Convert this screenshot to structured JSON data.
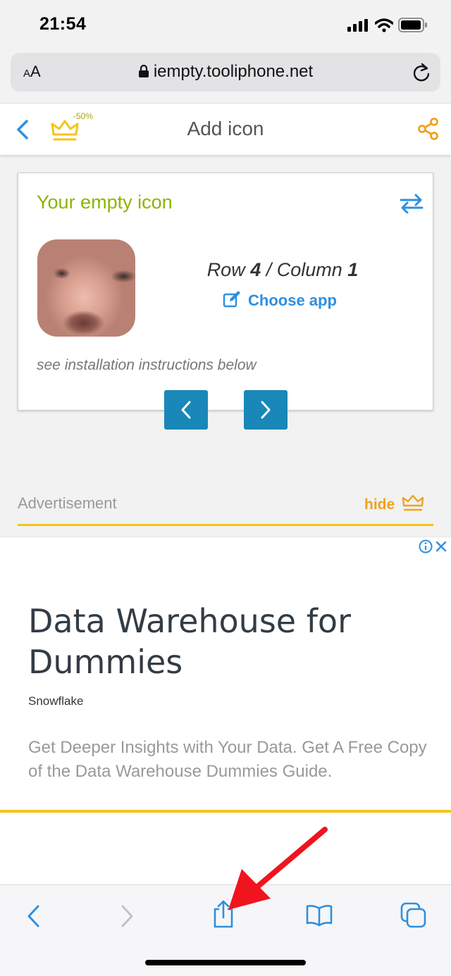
{
  "status_bar": {
    "time": "21:54"
  },
  "browser": {
    "text_size_label_small": "A",
    "text_size_label_big": "A",
    "url": "iempty.tooliphone.net"
  },
  "header": {
    "title": "Add icon",
    "discount": "-50%"
  },
  "icon_card": {
    "title": "Your empty icon",
    "row_prefix": "Row ",
    "row": "4",
    "separator": " / Column ",
    "column": "1",
    "choose_app": "Choose app",
    "instructions": "see installation instructions below"
  },
  "ad_section": {
    "label": "Advertisement",
    "hide": "hide"
  },
  "ad": {
    "headline": "Data Warehouse for Dummies",
    "brand": "Snowflake",
    "body": "Get Deeper Insights with Your Data. Get A Free Copy of the Data Warehouse Dummies Guide."
  },
  "colors": {
    "accent_blue": "#2e8fe0",
    "title_green": "#8cb500",
    "gold": "#f5c518",
    "nav_button": "#1987b8",
    "orange": "#f0a21c"
  },
  "icons": [
    "signal-icon",
    "wifi-icon",
    "battery-icon",
    "lock-icon",
    "reload-icon",
    "back-chevron-icon",
    "crown-icon",
    "share-icon",
    "swap-icon",
    "edit-icon",
    "info-icon",
    "close-icon",
    "prev-icon",
    "next-icon",
    "share-up-icon",
    "bookmarks-icon",
    "tabs-icon",
    "arrow-annotation"
  ]
}
